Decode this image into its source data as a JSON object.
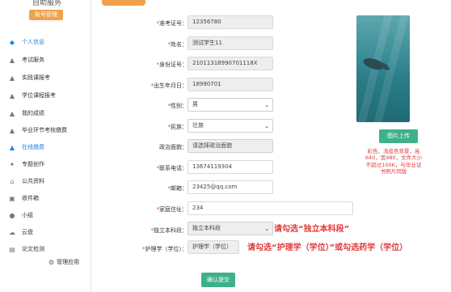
{
  "sidebar": {
    "top_name": "自助服务",
    "role_badge": "账号管理",
    "items": [
      {
        "label": "个人信息",
        "icon": "user-shield-icon",
        "active": true
      },
      {
        "label": "考试服务",
        "icon": "graduation-cap-icon"
      },
      {
        "label": "实践课报考",
        "icon": "graduation-cap-icon"
      },
      {
        "label": "学位课程报考",
        "icon": "graduation-cap-icon"
      },
      {
        "label": "我的成绩",
        "icon": "graduation-cap-icon"
      },
      {
        "label": "毕业环节考核缴费",
        "icon": "graduation-cap-icon"
      },
      {
        "label": "在线缴费",
        "icon": "graduation-cap-icon",
        "active_color": true
      },
      {
        "label": "专题创作",
        "icon": "magic-wand-icon"
      },
      {
        "label": "公共资料",
        "icon": "home-icon"
      },
      {
        "label": "收件箱",
        "icon": "inbox-icon"
      },
      {
        "label": "小组",
        "icon": "person-icon"
      },
      {
        "label": "云盘",
        "icon": "cloud-icon"
      },
      {
        "label": "论文检测",
        "icon": "document-icon"
      }
    ],
    "manage_app": "管理应用"
  },
  "form": {
    "admission_no": {
      "label": "准考证号：",
      "value": "12356780"
    },
    "name": {
      "label": "姓名：",
      "value": "测试学生11"
    },
    "id_no": {
      "label": "身份证号：",
      "value": "21011318990701118X"
    },
    "birth": {
      "label": "出生年月日：",
      "value": "18990701"
    },
    "gender": {
      "label": "性别：",
      "value": "男"
    },
    "ethnicity": {
      "label": "民族：",
      "value": "壮族"
    },
    "politics": {
      "label": "政治面貌：",
      "value": "请选择政治面貌"
    },
    "phone": {
      "label": "联系电话：",
      "value": "13674119304"
    },
    "email": {
      "label": "邮箱：",
      "value": "23425@qq.com"
    },
    "address": {
      "label": "家庭住址：",
      "value": "234"
    },
    "undergrad": {
      "label": "独立本科段：",
      "value": "独立本科段"
    },
    "nursing": {
      "label": "护理学（学位）：",
      "value": "护理学（学位）"
    }
  },
  "photo": {
    "upload_label": "图片上传",
    "note": "彩色、浅蓝色背景，高640，宽480，文件大小不超过100K，与毕业证书照片同版"
  },
  "annotations": {
    "undergrad": "请勾选“独立本科段”",
    "nursing": "请勾选“护理学（学位）”或勾选药学（学位）"
  },
  "submit_label": "确认提交",
  "colors": {
    "accent_orange": "#f0a24b",
    "accent_green": "#3fb08c",
    "annotation_red": "#e23b3b",
    "active_blue": "#1e88e5"
  }
}
